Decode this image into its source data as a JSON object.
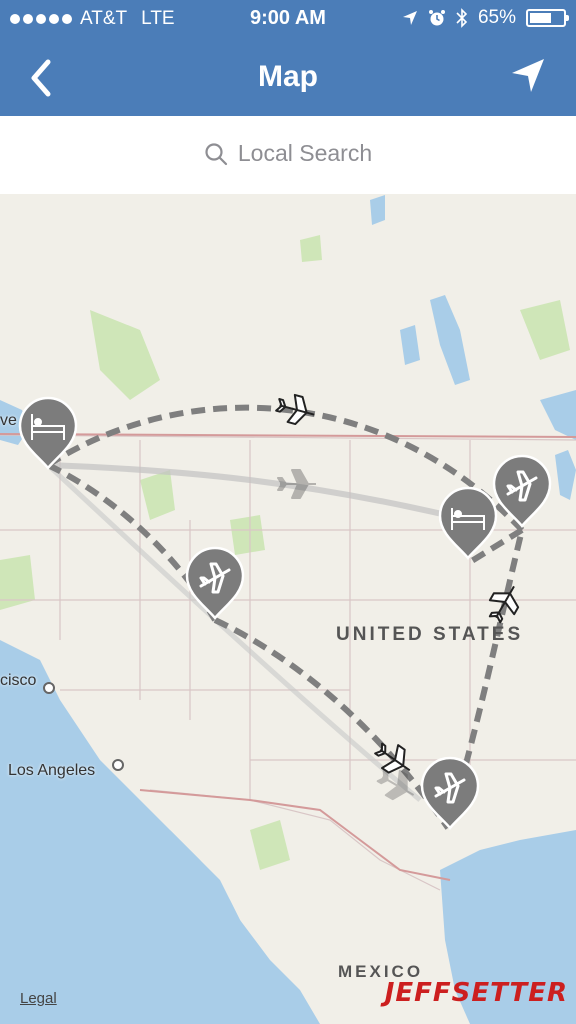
{
  "status": {
    "carrier": "AT&T",
    "network": "LTE",
    "time": "9:00 AM",
    "battery": "65%",
    "battery_level": 0.65
  },
  "nav": {
    "title": "Map",
    "back_icon": "chevron-left-icon",
    "location_icon": "location-arrow-icon"
  },
  "search": {
    "placeholder": "Local Search",
    "icon": "search-icon"
  },
  "map": {
    "labels": {
      "country_us": "UNITED STATES",
      "country_mx": "MEXICO",
      "city_la": "Los Angeles",
      "city_sf_partial": "cisco",
      "city_vancouver_partial": "ve"
    },
    "pins": [
      {
        "type": "hotel",
        "icon": "bed-icon"
      },
      {
        "type": "airport",
        "icon": "airplane-icon"
      },
      {
        "type": "hotel",
        "icon": "bed-icon"
      },
      {
        "type": "airport",
        "icon": "airplane-icon"
      },
      {
        "type": "airport",
        "icon": "airplane-icon"
      }
    ],
    "legal": "Legal",
    "watermark": "JEFFSETTER"
  },
  "colors": {
    "nav_blue": "#4b7db8",
    "land": "#f1efe8",
    "water": "#a9cde8",
    "park_green": "#cfe6b8",
    "route": "#7f7f7f",
    "pin": "#7c7c7c",
    "watermark": "#cc1f1f"
  }
}
